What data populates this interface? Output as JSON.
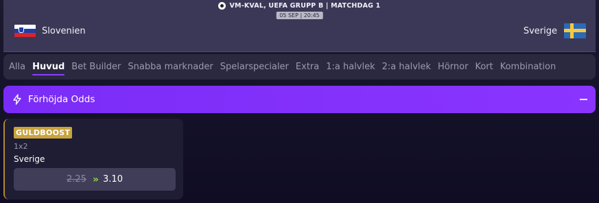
{
  "match": {
    "competition": "VM-KVAL, UEFA GRUPP B |  MATCHDAG  1",
    "kickoff": "05 SEP | 20:45",
    "home_team": "Slovenien",
    "away_team": "Sverige",
    "icons": {
      "competition": "football-icon",
      "home": "slovenia-flag-icon",
      "away": "sweden-flag-icon"
    }
  },
  "tabs": [
    {
      "label": "Alla",
      "active": false
    },
    {
      "label": "Huvud",
      "active": true
    },
    {
      "label": "Bet Builder",
      "active": false
    },
    {
      "label": "Snabba marknader",
      "active": false
    },
    {
      "label": "Spelarspecialer",
      "active": false
    },
    {
      "label": "Extra",
      "active": false
    },
    {
      "label": "1:a halvlek",
      "active": false
    },
    {
      "label": "2:a halvlek",
      "active": false
    },
    {
      "label": "Hörnor",
      "active": false
    },
    {
      "label": "Kort",
      "active": false
    },
    {
      "label": "Kombination",
      "active": false
    }
  ],
  "boosted_section": {
    "title": "Förhöjda Odds",
    "accent_color": "#8a35ff",
    "icons": {
      "title": "lightning-icon",
      "toggle": "minus-icon"
    }
  },
  "boost_card": {
    "badge": "GULDBOOST",
    "badge_color": "#c9a43b",
    "market": "1x2",
    "selection": "Sverige",
    "old_odds": "2.25",
    "new_odds": "3.10",
    "arrow_icon": "double-chevron-right-icon",
    "arrow_color": "#8fd14f"
  }
}
